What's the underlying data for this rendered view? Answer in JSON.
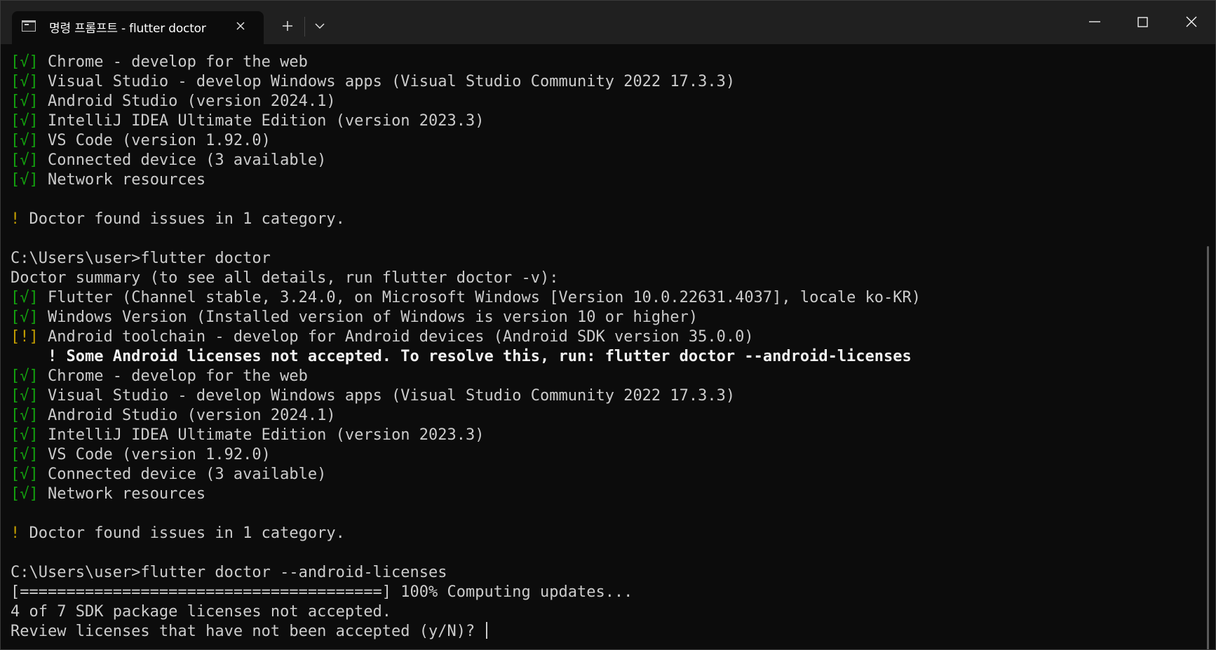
{
  "tab": {
    "title": "명령 프롬프트 - flutter  doctor",
    "icon": "terminal-icon"
  },
  "titlebar_icons": {
    "close_tab": "close-icon",
    "new_tab": "plus-icon",
    "dropdown": "chevron-down-icon",
    "minimize": "minimize-icon",
    "maximize": "maximize-icon",
    "close_window": "close-icon"
  },
  "colors": {
    "background": "#0c0c0c",
    "titlebar": "#202020",
    "text": "#cccccc",
    "ok": "#13a10e",
    "warn": "#c19c00"
  },
  "terminal": {
    "lines": [
      {
        "prefix": "[√]",
        "style": "ok",
        "text": " Chrome - develop for the web"
      },
      {
        "prefix": "[√]",
        "style": "ok",
        "text": " Visual Studio - develop Windows apps (Visual Studio Community 2022 17.3.3)"
      },
      {
        "prefix": "[√]",
        "style": "ok",
        "text": " Android Studio (version 2024.1)"
      },
      {
        "prefix": "[√]",
        "style": "ok",
        "text": " IntelliJ IDEA Ultimate Edition (version 2023.3)"
      },
      {
        "prefix": "[√]",
        "style": "ok",
        "text": " VS Code (version 1.92.0)"
      },
      {
        "prefix": "[√]",
        "style": "ok",
        "text": " Connected device (3 available)"
      },
      {
        "prefix": "[√]",
        "style": "ok",
        "text": " Network resources"
      },
      {
        "prefix": "",
        "style": "plain",
        "text": ""
      },
      {
        "prefix": "!",
        "style": "warn",
        "text": " Doctor found issues in 1 category."
      },
      {
        "prefix": "",
        "style": "plain",
        "text": ""
      },
      {
        "prefix": "",
        "style": "plain",
        "text": "C:\\Users\\user>flutter doctor"
      },
      {
        "prefix": "",
        "style": "plain",
        "text": "Doctor summary (to see all details, run flutter doctor -v):"
      },
      {
        "prefix": "[√]",
        "style": "ok",
        "text": " Flutter (Channel stable, 3.24.0, on Microsoft Windows [Version 10.0.22631.4037], locale ko-KR)"
      },
      {
        "prefix": "[√]",
        "style": "ok",
        "text": " Windows Version (Installed version of Windows is version 10 or higher)"
      },
      {
        "prefix": "[!]",
        "style": "warn",
        "text": " Android toolchain - develop for Android devices (Android SDK version 35.0.0)"
      },
      {
        "prefix": "",
        "style": "bold",
        "text": "    ! Some Android licenses not accepted. To resolve this, run: flutter doctor --android-licenses"
      },
      {
        "prefix": "[√]",
        "style": "ok",
        "text": " Chrome - develop for the web"
      },
      {
        "prefix": "[√]",
        "style": "ok",
        "text": " Visual Studio - develop Windows apps (Visual Studio Community 2022 17.3.3)"
      },
      {
        "prefix": "[√]",
        "style": "ok",
        "text": " Android Studio (version 2024.1)"
      },
      {
        "prefix": "[√]",
        "style": "ok",
        "text": " IntelliJ IDEA Ultimate Edition (version 2023.3)"
      },
      {
        "prefix": "[√]",
        "style": "ok",
        "text": " VS Code (version 1.92.0)"
      },
      {
        "prefix": "[√]",
        "style": "ok",
        "text": " Connected device (3 available)"
      },
      {
        "prefix": "[√]",
        "style": "ok",
        "text": " Network resources"
      },
      {
        "prefix": "",
        "style": "plain",
        "text": ""
      },
      {
        "prefix": "!",
        "style": "warn",
        "text": " Doctor found issues in 1 category."
      },
      {
        "prefix": "",
        "style": "plain",
        "text": ""
      },
      {
        "prefix": "",
        "style": "plain",
        "text": "C:\\Users\\user>flutter doctor --android-licenses"
      },
      {
        "prefix": "",
        "style": "plain",
        "text": "[=======================================] 100% Computing updates..."
      },
      {
        "prefix": "",
        "style": "plain",
        "text": "4 of 7 SDK package licenses not accepted."
      },
      {
        "prefix": "",
        "style": "plain",
        "text": "Review licenses that have not been accepted (y/N)? "
      }
    ]
  }
}
